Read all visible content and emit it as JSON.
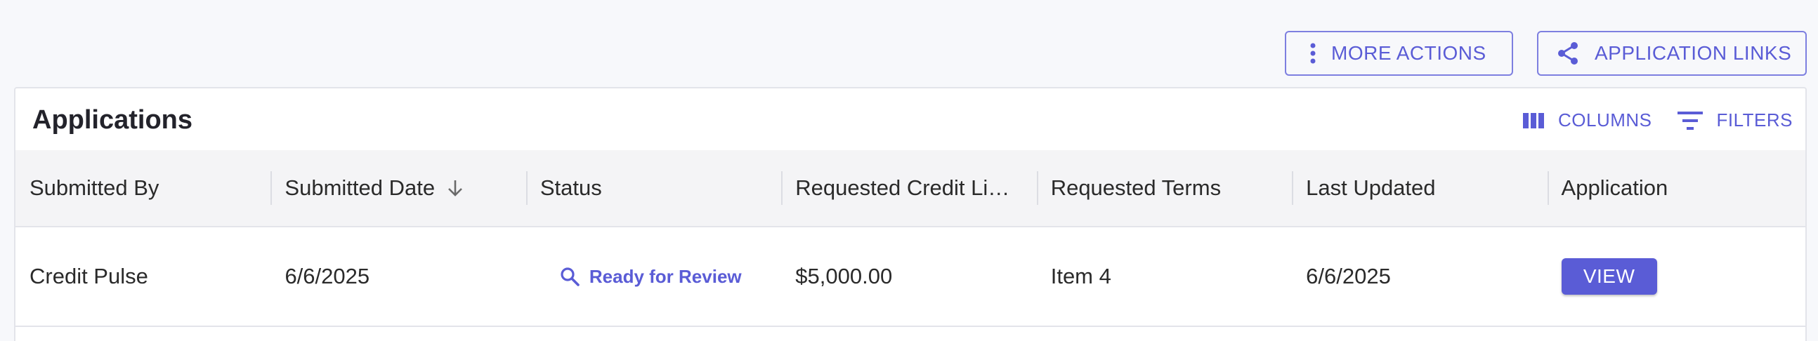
{
  "top_actions": {
    "more_actions": "MORE ACTIONS",
    "application_links": "APPLICATION LINKS"
  },
  "panel": {
    "title": "Applications",
    "toolbar": {
      "columns": "COLUMNS",
      "filters": "FILTERS"
    }
  },
  "table": {
    "headers": [
      "Submitted By",
      "Submitted Date",
      "Status",
      "Requested Credit Li…",
      "Requested Terms",
      "Last Updated",
      "Application"
    ],
    "sorted_column": "Submitted Date",
    "sort_direction": "descending",
    "rows": [
      {
        "submitted_by": "Credit Pulse",
        "submitted_date": "6/6/2025",
        "status": "Ready for Review",
        "requested_credit_limit": "$5,000.00",
        "requested_terms": "Item 4",
        "last_updated": "6/6/2025",
        "application_action": "VIEW"
      }
    ]
  },
  "icons": {
    "more_actions": "more-vertical-icon",
    "application_links": "share-icon",
    "columns": "columns-icon",
    "filters": "filter-icon",
    "sort": "arrow-down-icon",
    "status": "search-icon"
  },
  "colors": {
    "accent": "#5a5cd6",
    "background": "#f7f8fb",
    "header_bg": "#f4f4f6"
  }
}
